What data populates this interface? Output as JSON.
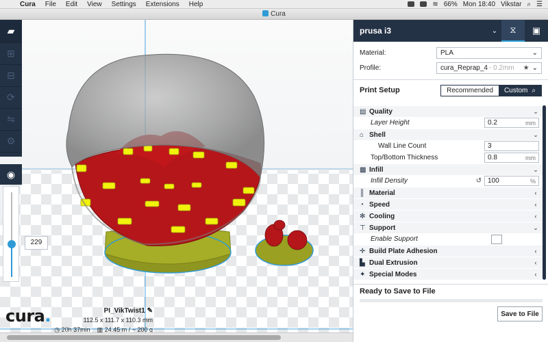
{
  "os_menubar": {
    "app_name": "Cura",
    "items": [
      "File",
      "Edit",
      "View",
      "Settings",
      "Extensions",
      "Help"
    ],
    "battery": "66%",
    "clock": "Mon 18:40",
    "user": "Vikstar"
  },
  "window": {
    "title": "Cura"
  },
  "viewport": {
    "layer_value": "229",
    "job": {
      "name": "PI_VikTwist1",
      "dimensions": "112.5 x 111.7 x 110.3 mm",
      "print_time": "20h 37min",
      "material_usage": "24.45 m / ~ 200 g"
    },
    "logo_text": "cura"
  },
  "sidebar": {
    "machine_name": "prusa i3",
    "material_label": "Material:",
    "material_value": "PLA",
    "profile_label": "Profile:",
    "profile_value": "cura_Reprap_4",
    "profile_sub": "- 0.2mm",
    "print_setup_title": "Print Setup",
    "mode_recommended": "Recommended",
    "mode_custom": "Custom",
    "categories": {
      "quality": "Quality",
      "shell": "Shell",
      "infill": "Infill",
      "material": "Material",
      "speed": "Speed",
      "cooling": "Cooling",
      "support": "Support",
      "adhesion": "Build Plate Adhesion",
      "dual": "Dual Extrusion",
      "special": "Special Modes"
    },
    "settings": {
      "layer_height": {
        "label": "Layer Height",
        "value": "0.2",
        "unit": "mm"
      },
      "wall_line_count": {
        "label": "Wall Line Count",
        "value": "3"
      },
      "top_bottom": {
        "label": "Top/Bottom Thickness",
        "value": "0.8",
        "unit": "mm"
      },
      "infill_density": {
        "label": "Infill Density",
        "value": "100",
        "unit": "%"
      },
      "enable_support": {
        "label": "Enable Support"
      }
    },
    "ready_text": "Ready to Save to File",
    "save_button": "Save to File"
  },
  "colors": {
    "accent": "#2f9bd6",
    "dark_panel": "#243245",
    "model_red": "#c2171a",
    "model_yellow": "#f2f20c",
    "base_olive": "#9aa021"
  }
}
